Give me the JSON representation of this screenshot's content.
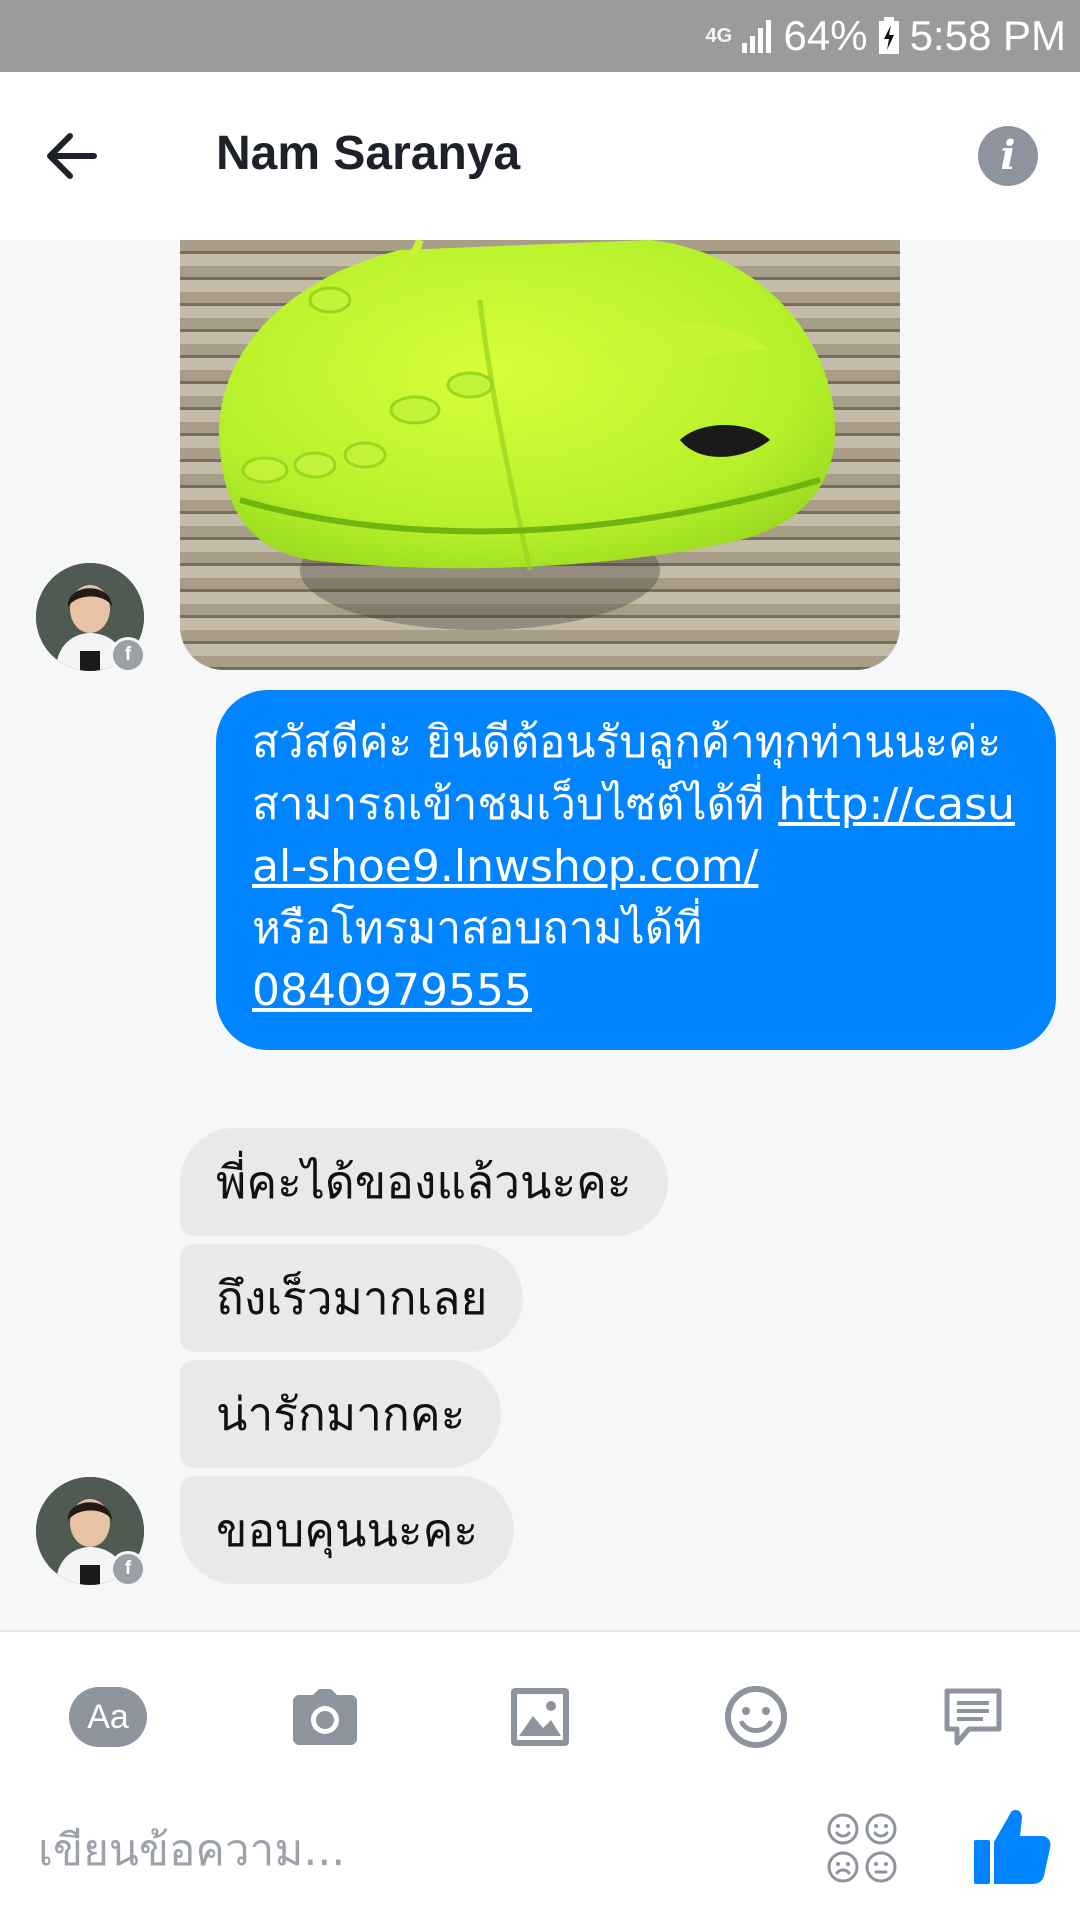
{
  "status_bar": {
    "network": "4G",
    "battery": "64%",
    "time": "5:58 PM"
  },
  "header": {
    "contact_name": "Nam Saranya",
    "icons": {
      "back": "arrow-left-icon",
      "info": "info-icon"
    },
    "info_glyph": "i"
  },
  "messages": {
    "outgoing": {
      "line1": "สวัสดีค่ะ ยินดีต้อนรับลูกค้าทุกท่านนะค่ะ",
      "line2": "สามารถเข้าชมเว็บไซต์ได้ที่ ",
      "link": "http://casual-shoe9.lnwshop.com/",
      "line3": "หรือโทรมาสอบถามได้ที่",
      "phone": "0840979555"
    },
    "incoming": [
      {
        "text": "พี่คะได้ของแล้วนะคะ"
      },
      {
        "text": "ถึงเร็วมากเลย"
      },
      {
        "text": "น่ารักมากคะ"
      },
      {
        "text": "ขอบคุนนะคะ"
      }
    ]
  },
  "avatar_badge": "f",
  "composer": {
    "text_mode_label": "Aa",
    "placeholder": "เขียนข้อความ...",
    "icons": [
      "camera-icon",
      "gallery-icon",
      "emoji-icon",
      "chat-bubble-icon",
      "emoji-grid-icon",
      "thumbs-up-icon"
    ]
  },
  "colors": {
    "messenger_blue": "#0084ff",
    "incoming_bubble": "#e9e9eb",
    "status_bar": "#9b9b9b",
    "icon_gray": "#8e949e"
  }
}
